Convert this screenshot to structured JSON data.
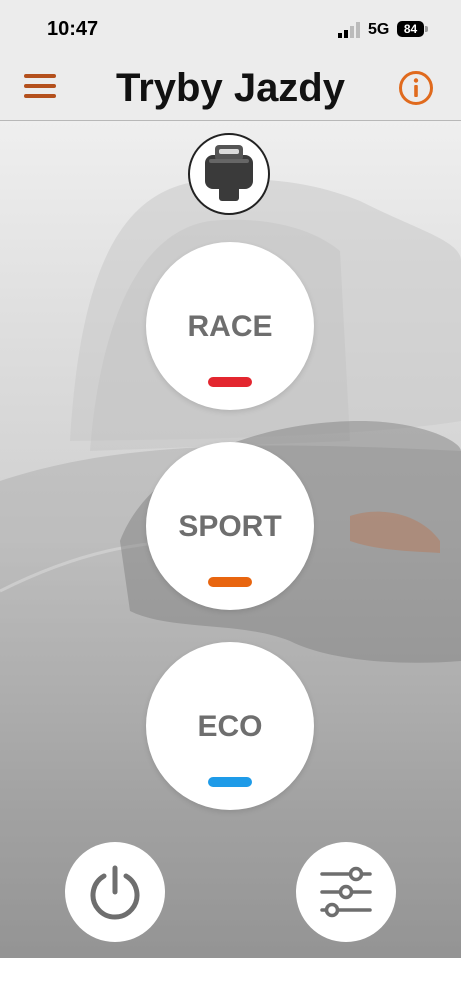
{
  "status_bar": {
    "time": "10:47",
    "network": "5G",
    "battery": "84"
  },
  "header": {
    "title": "Tryby Jazdy",
    "menu_icon": "hamburger-menu-icon",
    "info_icon": "info-icon"
  },
  "colors": {
    "accent": "#b4501d",
    "race": "#e3262f",
    "sport": "#e8650f",
    "eco": "#1e9be8"
  },
  "modes": [
    {
      "label": "RACE",
      "color": "#e3262f"
    },
    {
      "label": "SPORT",
      "color": "#e8650f"
    },
    {
      "label": "ECO",
      "color": "#1e9be8"
    }
  ],
  "bottom": {
    "power_icon": "power-icon",
    "settings_icon": "sliders-icon"
  }
}
